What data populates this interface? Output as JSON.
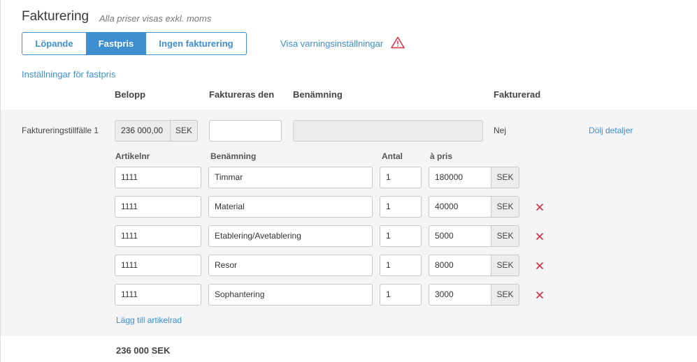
{
  "header": {
    "title": "Fakturering",
    "subtitle": "Alla priser visas exkl. moms"
  },
  "billing_modes": [
    {
      "label": "Löpande",
      "active": false
    },
    {
      "label": "Fastpris",
      "active": true
    },
    {
      "label": "Ingen fakturering",
      "active": false
    }
  ],
  "warning_link": "Visa varningsinställningar",
  "fixed_settings_link": "Inställningar för fastpris",
  "columns": {
    "amount": "Belopp",
    "billed_on": "Faktureras den",
    "name": "Benämning",
    "billed": "Fakturerad"
  },
  "occasion": {
    "label": "Faktureringstillfälle 1",
    "amount": "236 000,00",
    "currency": "SEK",
    "billed_on": "",
    "name": "",
    "billed": "Nej",
    "toggle_link": "Dölj detaljer"
  },
  "article_columns": {
    "article_no": "Artikelnr",
    "name": "Benämning",
    "qty": "Antal",
    "unit_price": "à pris"
  },
  "articles": [
    {
      "article_no": "1111",
      "name": "Timmar",
      "qty": "1",
      "price": "180000",
      "currency": "SEK"
    },
    {
      "article_no": "1111",
      "name": "Material",
      "qty": "1",
      "price": "40000",
      "currency": "SEK"
    },
    {
      "article_no": "1111",
      "name": "Etablering/Avetablering",
      "qty": "1",
      "price": "5000",
      "currency": "SEK"
    },
    {
      "article_no": "1111",
      "name": "Resor",
      "qty": "1",
      "price": "8000",
      "currency": "SEK"
    },
    {
      "article_no": "1111",
      "name": "Sophantering",
      "qty": "1",
      "price": "3000",
      "currency": "SEK"
    }
  ],
  "add_row_link": "Lägg till artikelrad",
  "total": "236 000 SEK",
  "icons": {
    "warning": "warning-triangle-icon",
    "delete": "close-icon"
  },
  "colors": {
    "accent": "#3d8fd0",
    "danger": "#d0354a",
    "band": "#f4f4f5"
  }
}
